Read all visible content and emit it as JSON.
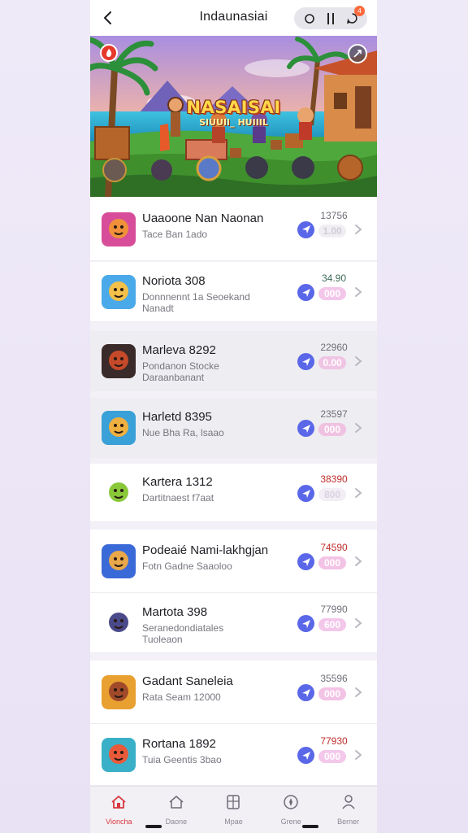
{
  "header": {
    "title": "Indaunasiai",
    "badge": "4"
  },
  "banner": {
    "title": "NASAISAI",
    "subtitle": "SIUUII_ HUIIIL"
  },
  "items": [
    {
      "title": "Uaaoone Nan Naonan",
      "desc": "Tace Ban 1ado",
      "price": "13756",
      "pill": "1.00",
      "pill_bg": "#f0eef3",
      "pill_color": "#cfcdd6",
      "price_color": "#6f6f78",
      "shaded": false
    },
    {
      "title": "Noriota 308",
      "desc": "Donnnennt 1a Seoekand Nanadt",
      "price": "34.90",
      "pill": "000",
      "pill_bg": "#f3c7ea",
      "pill_color": "#ffffff",
      "price_color": "#3d6b57",
      "shaded": false
    },
    {
      "title": "Marleva 8292",
      "desc": "Pondanon Stocke Daraanbanant",
      "price": "22960",
      "pill": "0.00",
      "pill_bg": "#f0c4e4",
      "pill_color": "#ffffff",
      "price_color": "#6f6f78",
      "shaded": true
    },
    {
      "title": "Harletd 8395",
      "desc": "Nue Bha Ra, lsaao",
      "price": "23597",
      "pill": "000",
      "pill_bg": "#f0c2e2",
      "pill_color": "#ffffff",
      "price_color": "#6f6f78",
      "shaded": true
    },
    {
      "title": "Kartera 1312",
      "desc": "Dartitnaest f7aat",
      "price": "38390",
      "pill": "800",
      "pill_bg": "#f3eef6",
      "pill_color": "#d9d3e0",
      "price_color": "#c02d2d",
      "shaded": false
    },
    {
      "title": "Podeaié Nami-lakhgjan",
      "desc": "Fotn Gadne Saaoloo",
      "price": "74590",
      "pill": "000",
      "pill_bg": "#f3c3e6",
      "pill_color": "#ffffff",
      "price_color": "#c02d2d",
      "shaded": false
    },
    {
      "title": "Martota 398",
      "desc": "Seranedondiatales Tuoleaon",
      "price": "77990",
      "pill": "600",
      "pill_bg": "#f3c7ea",
      "pill_color": "#ffffff",
      "price_color": "#6f6f78",
      "shaded": false
    },
    {
      "title": "Gadant Saneleia",
      "desc": "Rata Seam 12000",
      "price": "35596",
      "pill": "000",
      "pill_bg": "#f3c3e6",
      "pill_color": "#ffffff",
      "price_color": "#6f6f78",
      "shaded": false
    },
    {
      "title": "Rortana 1892",
      "desc": "Tuia Geentis 3bao",
      "price": "77930",
      "pill": "000",
      "pill_bg": "#f3c8ea",
      "pill_color": "#ffffff",
      "price_color": "#c02d2d",
      "shaded": false
    }
  ],
  "tabs": [
    {
      "label": "Vioncha",
      "icon": "home-icon",
      "active": true
    },
    {
      "label": "Daone",
      "icon": "house-icon",
      "active": false
    },
    {
      "label": "Mpae",
      "icon": "grid-icon",
      "active": false
    },
    {
      "label": "Grene",
      "icon": "compass-icon",
      "active": false
    },
    {
      "label": "Berner",
      "icon": "person-icon",
      "active": false
    }
  ]
}
